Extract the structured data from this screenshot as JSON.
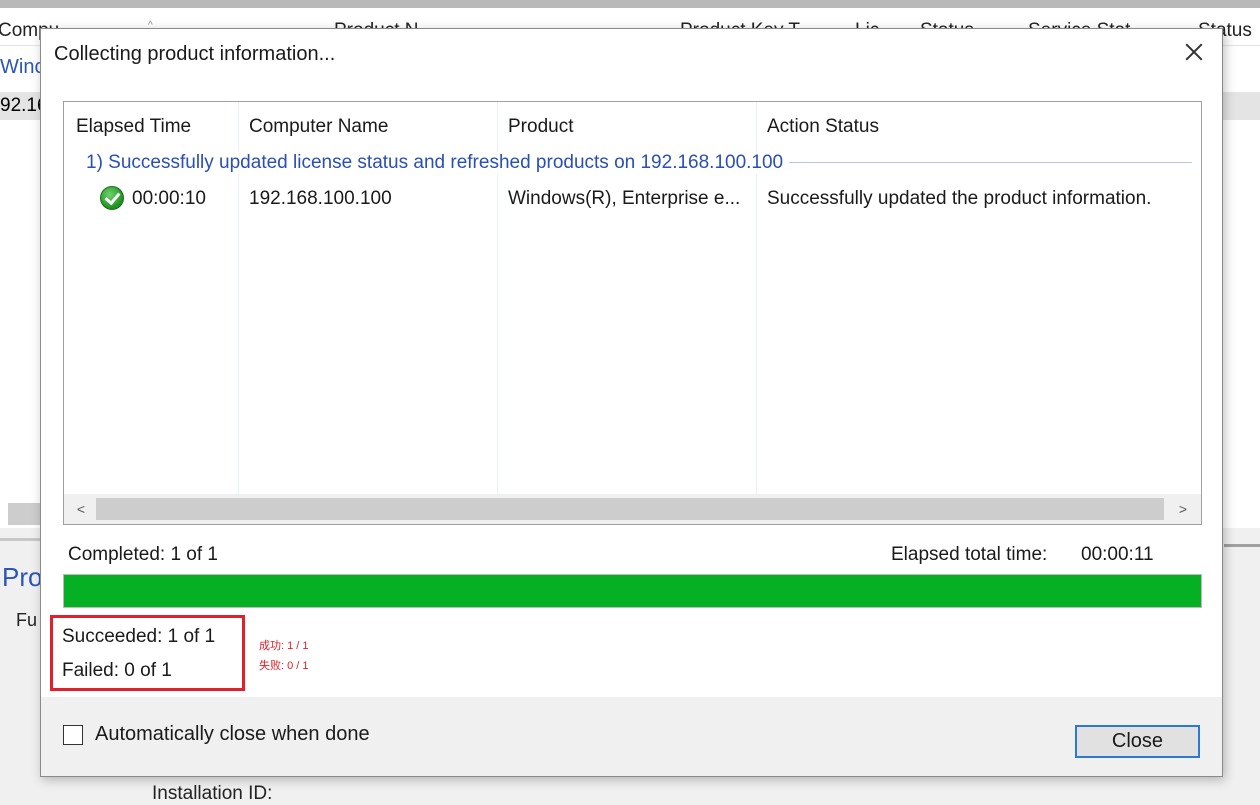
{
  "background": {
    "headers": [
      "Compu",
      "Product N",
      "Product Key T",
      "Lic",
      "Status",
      "Service Stat",
      "Status"
    ],
    "row1": "Winc",
    "row2": "92.16",
    "section_title": "Pro",
    "field_label": "Fu",
    "bottom_label": "Installation ID:"
  },
  "dialog": {
    "title": "Collecting product information...",
    "columns": [
      "Elapsed Time",
      "Computer Name",
      "Product",
      "Action Status"
    ],
    "group_header": "1) Successfully updated license status and refreshed products on 192.168.100.100",
    "rows": [
      {
        "elapsed": "00:00:10",
        "computer": "192.168.100.100",
        "product": "Windows(R), Enterprise e...",
        "status": "Successfully updated the product information.",
        "icon": "success-check-icon"
      }
    ],
    "completed": "Completed: 1 of 1",
    "elapsed_total_label": "Elapsed total time:",
    "elapsed_total_value": "00:00:11",
    "progress_fraction": 1.0,
    "progress_color": "#06b025",
    "succeeded": "Succeeded: 1 of 1",
    "failed": "Failed: 0 of 1",
    "annotation_1": "成功: 1 / 1",
    "annotation_2": "失败: 0 / 1",
    "annotation_color": "#e0202a",
    "auto_close_label": "Automatically close when done",
    "auto_close_checked": false,
    "close_button": "Close"
  }
}
